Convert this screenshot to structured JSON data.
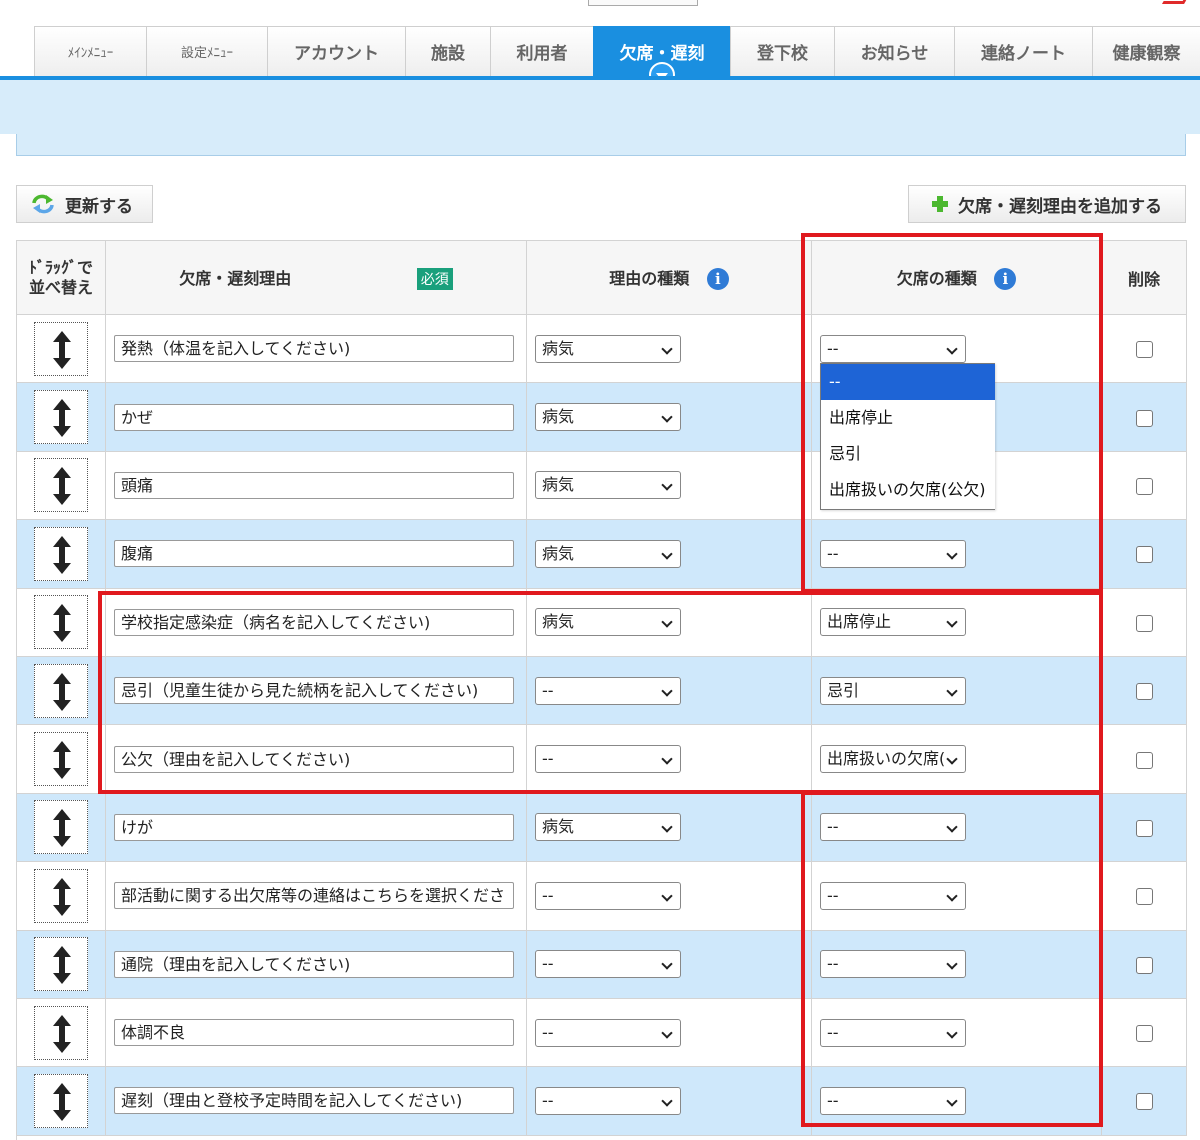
{
  "header": {
    "tabs": [
      {
        "label": "ﾒｲﾝﾒﾆｭｰ",
        "width": 112,
        "small": true,
        "active": false
      },
      {
        "label": "設定ﾒﾆｭｰ",
        "width": 121,
        "small": true,
        "active": false
      },
      {
        "label": "アカウント",
        "width": 138,
        "small": false,
        "active": false
      },
      {
        "label": "施設",
        "width": 85,
        "small": false,
        "active": false
      },
      {
        "label": "利用者",
        "width": 103,
        "small": false,
        "active": false
      },
      {
        "label": "欠席・遅刻",
        "width": 137,
        "small": false,
        "active": true
      },
      {
        "label": "登下校",
        "width": 104,
        "small": false,
        "active": false
      },
      {
        "label": "お知らせ",
        "width": 120,
        "small": false,
        "active": false
      },
      {
        "label": "連絡ノート",
        "width": 138,
        "small": false,
        "active": false
      },
      {
        "label": "健康観察",
        "width": 108,
        "small": false,
        "active": false
      }
    ]
  },
  "toolbar": {
    "refresh_label": "更新する",
    "add_label": "欠席・遅刻理由を追加する"
  },
  "table": {
    "headers": {
      "drag": [
        "ﾄﾞﾗｯｸﾞで",
        "並べ替え"
      ],
      "reason": "欠席・遅刻理由",
      "required_badge": "必須",
      "type": "理由の種類",
      "absence": "欠席の種類",
      "delete": "削除"
    },
    "rows": [
      {
        "reason": "発熱（体温を記入してください)",
        "type": "病気",
        "absence": "--",
        "bg": "white"
      },
      {
        "reason": "かぜ",
        "type": "病気",
        "absence": "",
        "bg": "blue"
      },
      {
        "reason": "頭痛",
        "type": "病気",
        "absence": "",
        "bg": "white"
      },
      {
        "reason": "腹痛",
        "type": "病気",
        "absence": "--",
        "bg": "blue"
      },
      {
        "reason": "学校指定感染症（病名を記入してください)",
        "type": "病気",
        "absence": "出席停止",
        "bg": "white"
      },
      {
        "reason": "忌引（児童生徒から見た続柄を記入してください)",
        "type": "--",
        "absence": "忌引",
        "bg": "blue"
      },
      {
        "reason": "公欠（理由を記入してください)",
        "type": "--",
        "absence": "出席扱いの欠席(",
        "bg": "white"
      },
      {
        "reason": "けが",
        "type": "病気",
        "absence": "--",
        "bg": "blue"
      },
      {
        "reason": "部活動に関する出欠席等の連絡はこちらを選択くださ",
        "type": "--",
        "absence": "--",
        "bg": "white"
      },
      {
        "reason": "通院（理由を記入してください)",
        "type": "--",
        "absence": "--",
        "bg": "blue"
      },
      {
        "reason": "体調不良",
        "type": "--",
        "absence": "--",
        "bg": "white"
      },
      {
        "reason": "遅刻（理由と登校予定時間を記入してください)",
        "type": "--",
        "absence": "--",
        "bg": "blue"
      }
    ]
  },
  "absence_dropdown": {
    "options": [
      "--",
      "出席停止",
      "忌引",
      "出席扱いの欠席(公欠)"
    ],
    "highlighted_index": 0
  },
  "colors": {
    "accent": "#1a8fe0",
    "row_blue": "#cfe8fb",
    "highlight_red": "#e0191e",
    "required_green": "#1aa07c"
  }
}
